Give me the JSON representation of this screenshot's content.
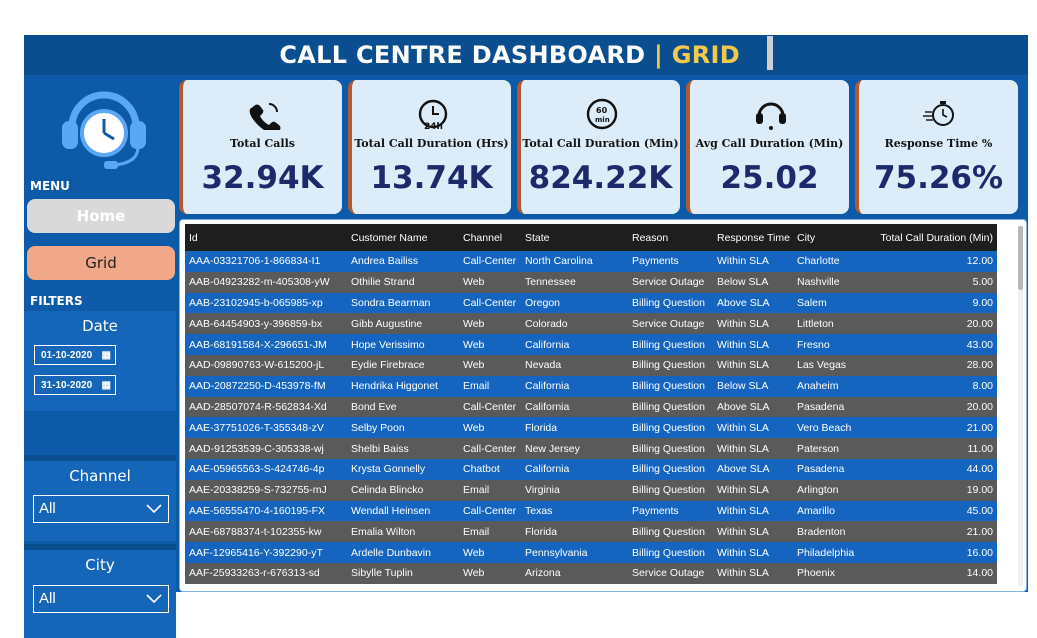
{
  "header": {
    "title_main": "CALL CENTRE DASHBOARD",
    "title_sep": "|",
    "title_sub": "GRID"
  },
  "sidebar": {
    "menu_label": "MENU",
    "nav": [
      {
        "label": "Home"
      },
      {
        "label": "Grid"
      }
    ],
    "filters_label": "FILTERS",
    "date": {
      "title": "Date",
      "start": "01-10-2020",
      "end": "31-10-2020"
    },
    "channel": {
      "title": "Channel",
      "value": "All"
    },
    "city": {
      "title": "City",
      "value": "All"
    }
  },
  "kpis": [
    {
      "label": "Total Calls",
      "value": "32.94K",
      "icon": "phone-icon"
    },
    {
      "label": "Total Call Duration (Hrs)",
      "value": "13.74K",
      "icon": "24h-clock-icon"
    },
    {
      "label": "Total Call Duration (Min)",
      "value": "824.22K",
      "icon": "60-min-icon"
    },
    {
      "label": "Avg Call Duration (Min)",
      "value": "25.02",
      "icon": "headset-icon"
    },
    {
      "label": "Response Time %",
      "value": "75.26%",
      "icon": "stopwatch-icon"
    }
  ],
  "table": {
    "columns": [
      "Id",
      "Customer Name",
      "Channel",
      "State",
      "Reason",
      "Response Time",
      "City",
      "Total Call Duration (Min)"
    ],
    "rows": [
      [
        "AAA-03321706-1-866834-I1",
        "Andrea Bailiss",
        "Call-Center",
        "North Carolina",
        "Payments",
        "Within SLA",
        "Charlotte",
        "12.00"
      ],
      [
        "AAB-04923282-m-405308-yW",
        "Othilie Strand",
        "Web",
        "Tennessee",
        "Service Outage",
        "Below SLA",
        "Nashville",
        "5.00"
      ],
      [
        "AAB-23102945-b-065985-xp",
        "Sondra Bearman",
        "Call-Center",
        "Oregon",
        "Billing Question",
        "Above SLA",
        "Salem",
        "9.00"
      ],
      [
        "AAB-64454903-y-396859-bx",
        "Gibb Augustine",
        "Web",
        "Colorado",
        "Service Outage",
        "Within SLA",
        "Littleton",
        "20.00"
      ],
      [
        "AAB-68191584-X-296651-JM",
        "Hope Verissimo",
        "Web",
        "California",
        "Billing Question",
        "Within SLA",
        "Fresno",
        "43.00"
      ],
      [
        "AAD-09890763-W-615200-jL",
        "Eydie Firebrace",
        "Web",
        "Nevada",
        "Billing Question",
        "Within SLA",
        "Las Vegas",
        "28.00"
      ],
      [
        "AAD-20872250-D-453978-fM",
        "Hendrika Higgonet",
        "Email",
        "California",
        "Billing Question",
        "Below SLA",
        "Anaheim",
        "8.00"
      ],
      [
        "AAD-28507074-R-562834-Xd",
        "Bond Eve",
        "Call-Center",
        "California",
        "Billing Question",
        "Above SLA",
        "Pasadena",
        "20.00"
      ],
      [
        "AAE-37751026-T-355348-zV",
        "Selby Poon",
        "Web",
        "Florida",
        "Billing Question",
        "Within SLA",
        "Vero Beach",
        "21.00"
      ],
      [
        "AAD-91253539-C-305338-wj",
        "Shelbi Baiss",
        "Call-Center",
        "New Jersey",
        "Billing Question",
        "Within SLA",
        "Paterson",
        "11.00"
      ],
      [
        "AAE-05965563-S-424746-4p",
        "Krysta Gonnelly",
        "Chatbot",
        "California",
        "Billing Question",
        "Above SLA",
        "Pasadena",
        "44.00"
      ],
      [
        "AAE-20338259-S-732755-mJ",
        "Celinda Blincko",
        "Email",
        "Virginia",
        "Billing Question",
        "Within SLA",
        "Arlington",
        "19.00"
      ],
      [
        "AAE-56555470-4-160195-FX",
        "Wendall Heinsen",
        "Call-Center",
        "Texas",
        "Payments",
        "Within SLA",
        "Amarillo",
        "45.00"
      ],
      [
        "AAE-68788374-t-102355-kw",
        "Emalia Wilton",
        "Email",
        "Florida",
        "Billing Question",
        "Within SLA",
        "Bradenton",
        "21.00"
      ],
      [
        "AAF-12965416-Y-392290-yT",
        "Ardelle Dunbavin",
        "Web",
        "Pennsylvania",
        "Billing Question",
        "Within SLA",
        "Philadelphia",
        "16.00"
      ],
      [
        "AAF-25933263-r-676313-sd",
        "Sibylle Tuplin",
        "Web",
        "Arizona",
        "Service Outage",
        "Within SLA",
        "Phoenix",
        "14.00"
      ]
    ]
  }
}
